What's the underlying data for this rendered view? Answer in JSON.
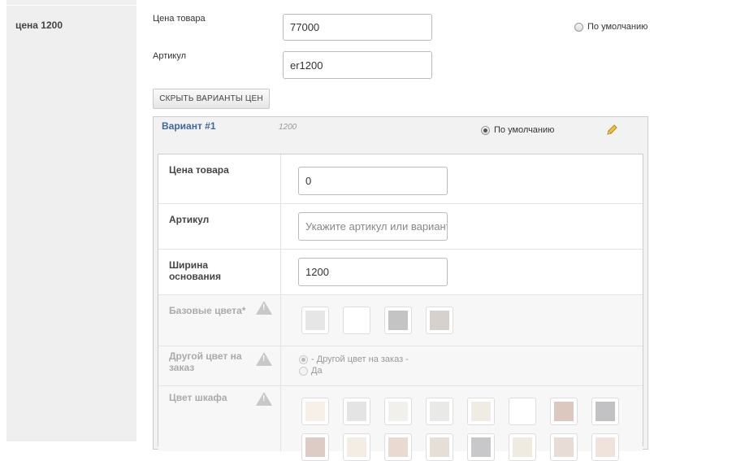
{
  "sidebar": {
    "label": "цена 1200"
  },
  "product": {
    "price_label": "Цена товара",
    "price_value": "77000",
    "sku_label": "Артикул",
    "sku_value": "er1200",
    "default_label": "По умолчанию"
  },
  "toggle_button": "СКРЫТЬ ВАРИАНТЫ ЦЕН",
  "variant": {
    "title": "Вариант #1",
    "sku": "1200",
    "default_label": "По умолчанию",
    "rows": {
      "price": {
        "label": "Цена товара",
        "value": "0"
      },
      "sku": {
        "label": "Артикул",
        "placeholder": "Укажите артикул или вариант"
      },
      "width": {
        "label": "Ширина основания",
        "value": "1200"
      },
      "base_colors": {
        "label": "Базовые цвета*",
        "swatches": [
          "#e6e6e6",
          "#ffffff",
          "#c4c4c4",
          "#d7d1ce"
        ]
      },
      "other_color": {
        "label": "Другой цвет на заказ",
        "options": [
          "- Другой цвет на заказ -",
          "Да"
        ]
      },
      "cabinet_color": {
        "label": "Цвет шкафа",
        "swatches": [
          "#f6f0e8",
          "#e4e4e4",
          "#f2f0ea",
          "#e9e9e7",
          "#eeece3",
          "#ffffff",
          "#dcc8bf",
          "#c2c2c4",
          "#dcccc5",
          "#f3ede4",
          "#e9d9d1",
          "#e5dfd8",
          "#c8c8cb",
          "#f0ebe1",
          "#e7ddd6",
          "#efe3db"
        ]
      }
    }
  },
  "icons": {
    "warning": "warning-icon",
    "edit": "pencil-icon"
  },
  "colors": {
    "link": "#3b67a3",
    "sidebar": "#efefef"
  }
}
